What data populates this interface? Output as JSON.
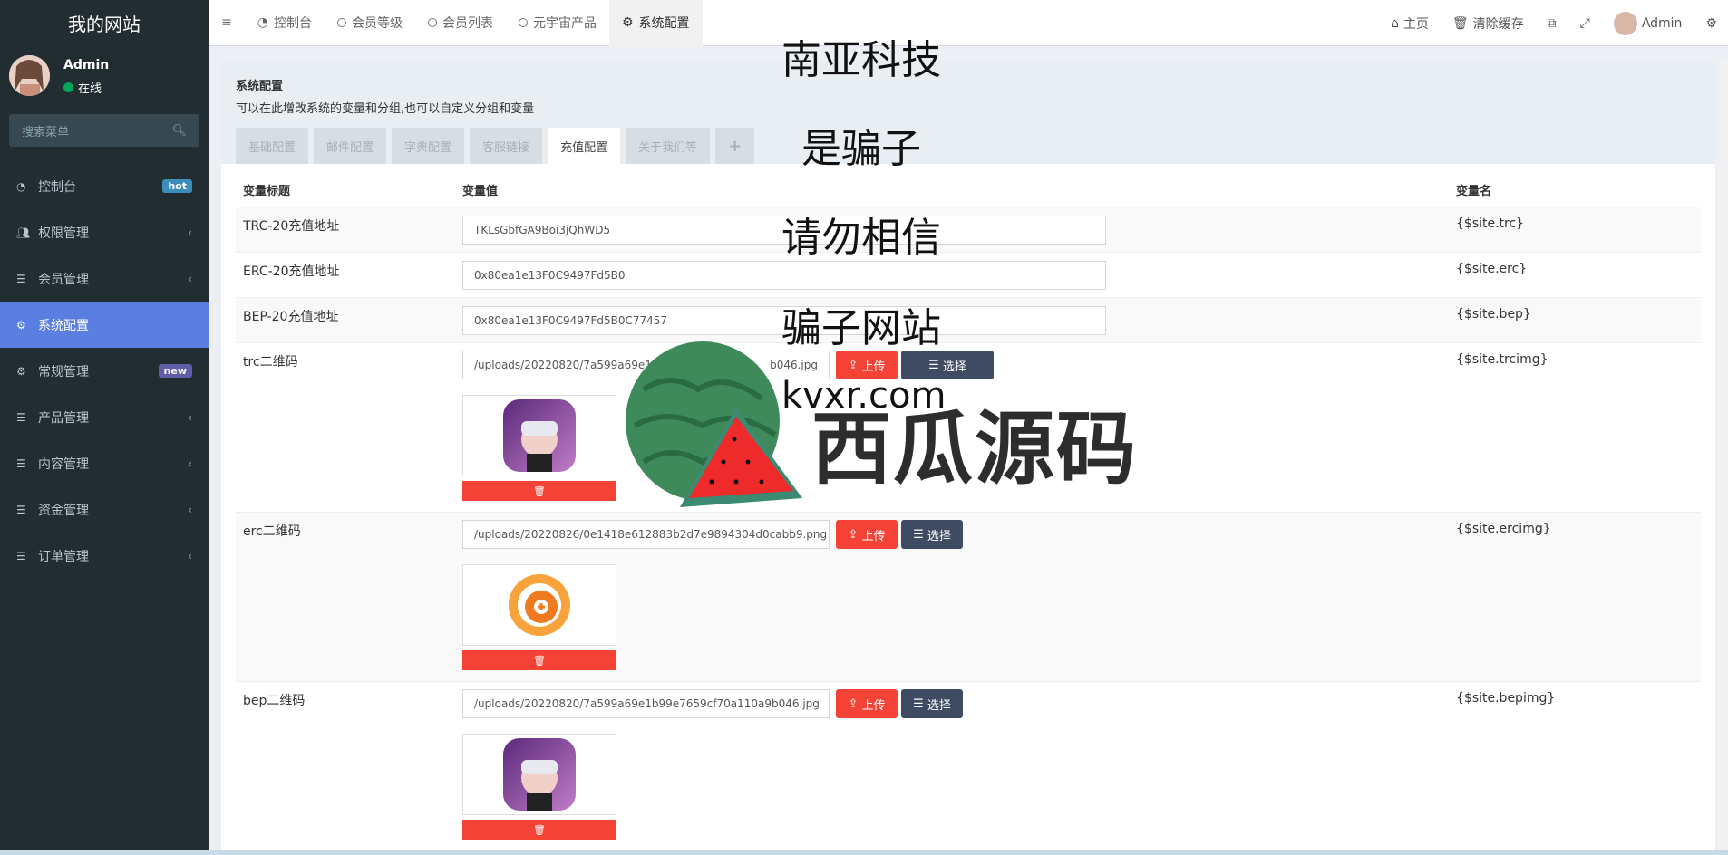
{
  "sidebar": {
    "site_title": "我的网站",
    "user": {
      "name": "Admin",
      "status": "在线"
    },
    "search_placeholder": "搜索菜单",
    "items": [
      {
        "label": "控制台",
        "icon": "dashboard-icon",
        "badge": "hot",
        "badge_color": "#3c8dbc"
      },
      {
        "label": "权限管理",
        "icon": "users-icon",
        "chevron": "‹"
      },
      {
        "label": "会员管理",
        "icon": "list-icon",
        "chevron": "‹"
      },
      {
        "label": "系统配置",
        "icon": "gear-icon",
        "active": true
      },
      {
        "label": "常规管理",
        "icon": "gears-icon",
        "badge": "new",
        "badge_color": "#605ca8"
      },
      {
        "label": "产品管理",
        "icon": "list-icon",
        "chevron": "‹"
      },
      {
        "label": "内容管理",
        "icon": "list-icon",
        "chevron": "‹"
      },
      {
        "label": "资金管理",
        "icon": "list-icon",
        "chevron": "‹"
      },
      {
        "label": "订单管理",
        "icon": "list-icon",
        "chevron": "‹"
      }
    ]
  },
  "topbar": {
    "tabs": [
      {
        "label": "控制台",
        "icon": "dashboard-icon"
      },
      {
        "label": "会员等级",
        "icon": "circle-icon"
      },
      {
        "label": "会员列表",
        "icon": "circle-icon"
      },
      {
        "label": "元宇宙产品",
        "icon": "circle-icon"
      },
      {
        "label": "系统配置",
        "icon": "gear-icon",
        "active": true
      }
    ],
    "right": {
      "home": "主页",
      "clear_cache": "清除缓存",
      "user": "Admin"
    }
  },
  "panel": {
    "title": "系统配置",
    "desc": "可以在此增改系统的变量和分组,也可以自定义分组和变量",
    "tabs": [
      "基础配置",
      "邮件配置",
      "字典配置",
      "客服链接",
      "充值配置",
      "关于我们等"
    ],
    "active_tab": "充值配置",
    "add_tab": "+"
  },
  "table": {
    "headers": [
      "变量标题",
      "变量值",
      "变量名"
    ],
    "rows": [
      {
        "title": "TRC-20充值地址",
        "value": "TKLsGbfGA9Boi3jQhWD5",
        "var": "{$site.trc}"
      },
      {
        "title": "ERC-20充值地址",
        "value": "0x80ea1e13F0C9497Fd5B0",
        "var": "{$site.erc}"
      },
      {
        "title": "BEP-20充值地址",
        "value": "0x80ea1e13F0C9497Fd5B0C77457",
        "var": "{$site.bep}"
      },
      {
        "title": "trc二维码",
        "value": "/uploads/20220820/7a599a69e1",
        "value_tail": "b046.jpg",
        "var": "{$site.trcimg}"
      },
      {
        "title": "erc二维码",
        "value": "/uploads/20220826/0e1418e612883b2d7e9894304d0cabb9.png",
        "var": "{$site.ercimg}"
      },
      {
        "title": "bep二维码",
        "value": "/uploads/20220820/7a599a69e1b99e7659cf70a110a9b046.jpg",
        "var": "{$site.bepimg}"
      }
    ],
    "upload_label": "上传",
    "choose_label": "选择"
  },
  "overlay": {
    "lines": [
      "南亚科技",
      "是骗子",
      "请勿相信",
      "骗子网站"
    ],
    "domain": "kvxr.com",
    "watermark": "西瓜源码"
  },
  "colors": {
    "sidebar_bg": "#222d32",
    "active_menu": "#5b7fe0",
    "danger": "#f44336",
    "navy": "#3f4a63",
    "online": "#00a65a"
  }
}
